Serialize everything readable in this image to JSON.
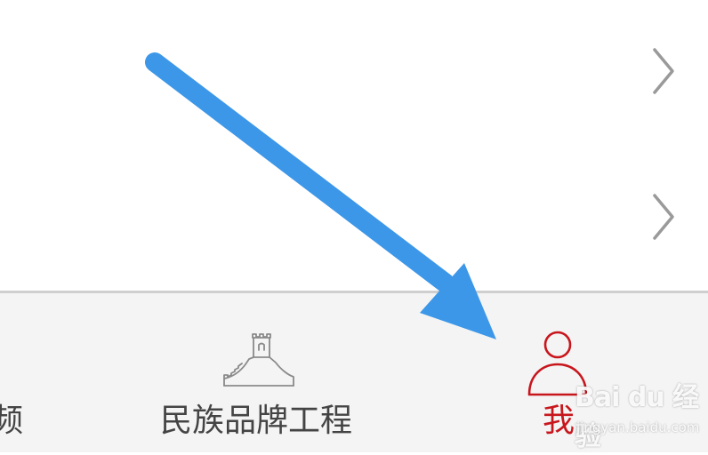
{
  "list": {
    "rows": [
      {
        "chevron_icon": "chevron-right-icon"
      },
      {
        "chevron_icon": "chevron-right-icon"
      }
    ]
  },
  "tab_bar": {
    "tabs": [
      {
        "id": "video",
        "label": "频",
        "icon": "none"
      },
      {
        "id": "brand",
        "label": "民族品牌工程",
        "icon": "great-wall-icon"
      },
      {
        "id": "me",
        "label": "我",
        "icon": "person-icon",
        "active": true
      }
    ]
  },
  "overlay": {
    "arrow_icon": "pointer-arrow-icon"
  },
  "watermark": {
    "logo": "Bai du 经验",
    "url": "jingyan.baidu.com"
  },
  "colors": {
    "active_tab": "#c8161d",
    "inactive_tab": "#444444",
    "tab_bar_bg": "#f4f4f4",
    "divider": "#cfcfcf",
    "chevron": "#9a9a9a",
    "annotation_arrow": "#3d97e8"
  }
}
